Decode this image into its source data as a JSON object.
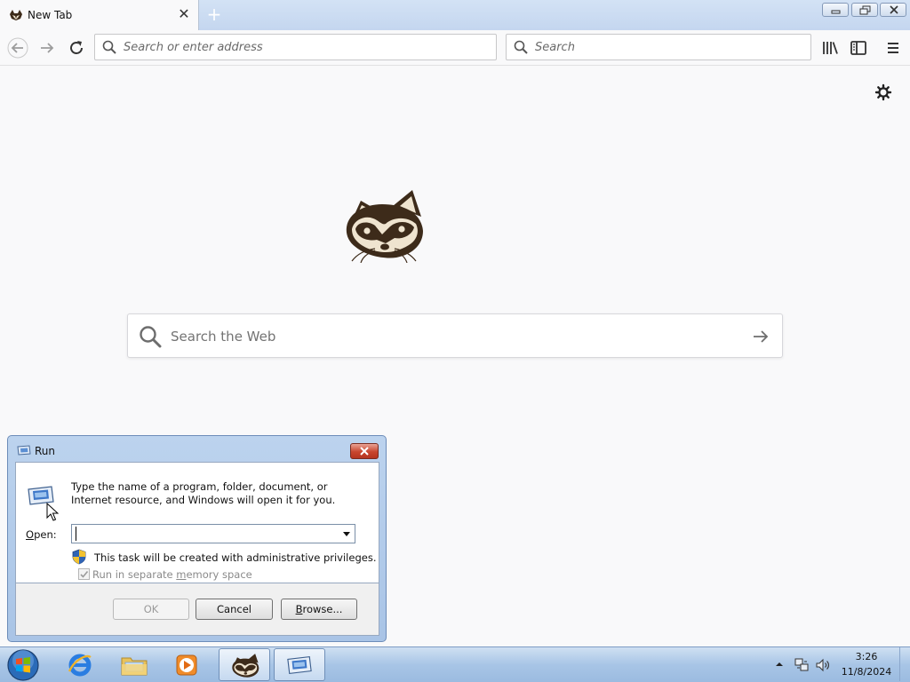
{
  "browser": {
    "tab": {
      "title": "New Tab",
      "close_icon": "close-icon"
    },
    "new_tab_symbol": "+",
    "url_placeholder": "Search or enter address",
    "search_placeholder": "Search"
  },
  "content": {
    "web_search_placeholder": "Search the Web"
  },
  "run_dialog": {
    "title": "Run",
    "description": "Type the name of a program, folder, document, or Internet resource, and Windows will open it for you.",
    "open_label_underlined": "O",
    "open_label_rest": "pen:",
    "open_value": "",
    "admin_text": "This task will be created with administrative privileges.",
    "separate_memory_pre": "Run in separate ",
    "separate_memory_underlined": "m",
    "separate_memory_post": "emory space",
    "separate_memory_checked": true,
    "ok_label": "OK",
    "cancel_label": "Cancel",
    "browse_label_pre": "",
    "browse_label_underlined": "B",
    "browse_label_post": "rowse..."
  },
  "taskbar": {
    "clock_time": "3:26",
    "clock_date": "11/8/2024"
  },
  "colors": {
    "accent": "#3c6fb3",
    "raccoon_dark": "#3d2b1a",
    "raccoon_light": "#efe4cf"
  }
}
